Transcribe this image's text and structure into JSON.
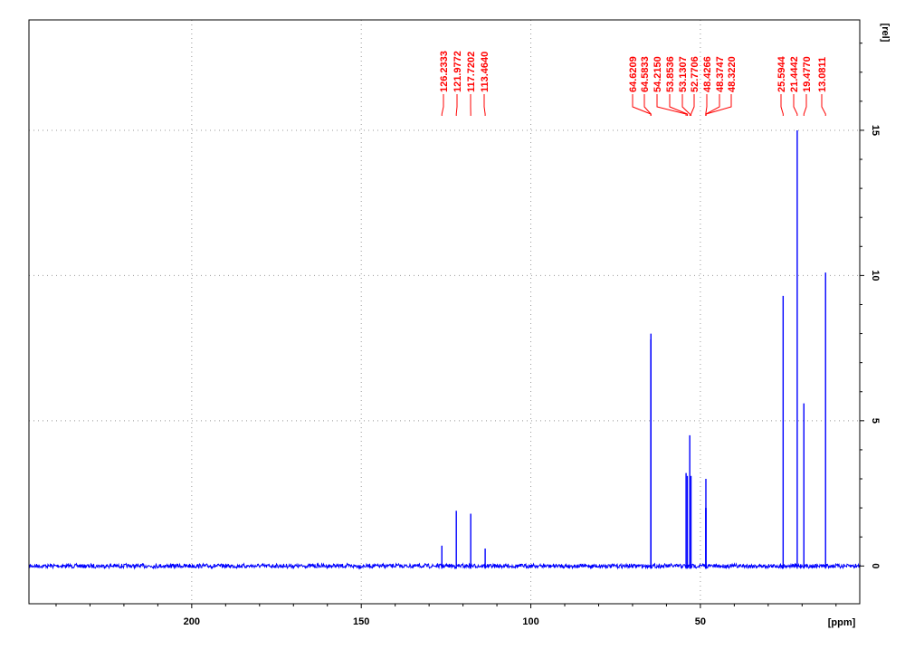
{
  "chart_data": {
    "type": "line",
    "title": "",
    "xlabel": "[ppm]",
    "ylabel": "[rel]",
    "xlim": [
      248,
      3
    ],
    "ylim": [
      -1.3,
      18.8
    ],
    "x_reversed": true,
    "x_ticks": [
      200,
      150,
      100,
      50
    ],
    "y_ticks": [
      0,
      5,
      10,
      15
    ],
    "grid": true,
    "colors": {
      "spectrum": "#0000ff",
      "peak_label": "#ff0000",
      "frame": "#000000",
      "grid": "#999999"
    },
    "peaks": [
      {
        "ppm": 126.2333,
        "height": 0.7
      },
      {
        "ppm": 121.9772,
        "height": 1.9
      },
      {
        "ppm": 117.7202,
        "height": 1.8
      },
      {
        "ppm": 113.464,
        "height": 0.6
      },
      {
        "ppm": 64.6209,
        "height": 7.8
      },
      {
        "ppm": 64.5833,
        "height": 8.0
      },
      {
        "ppm": 54.215,
        "height": 3.2
      },
      {
        "ppm": 53.8536,
        "height": 3.1
      },
      {
        "ppm": 53.1307,
        "height": 4.5
      },
      {
        "ppm": 52.7706,
        "height": 3.1
      },
      {
        "ppm": 48.4266,
        "height": 2.0
      },
      {
        "ppm": 48.3747,
        "height": 3.0
      },
      {
        "ppm": 48.322,
        "height": 2.0
      },
      {
        "ppm": 25.5944,
        "height": 9.3
      },
      {
        "ppm": 21.4442,
        "height": 15.0
      },
      {
        "ppm": 19.477,
        "height": 5.6
      },
      {
        "ppm": 13.0811,
        "height": 10.1
      }
    ],
    "peak_labels": [
      {
        "text": "126.2333",
        "ppm": 126.2333
      },
      {
        "text": "121.9772",
        "ppm": 121.9772
      },
      {
        "text": "117.7202",
        "ppm": 117.7202
      },
      {
        "text": "113.4640",
        "ppm": 113.464
      },
      {
        "text": "64.6209",
        "ppm": 64.6209
      },
      {
        "text": "64.5833",
        "ppm": 64.5833
      },
      {
        "text": "54.2150",
        "ppm": 54.215
      },
      {
        "text": "53.8536",
        "ppm": 53.8536
      },
      {
        "text": "53.1307",
        "ppm": 53.1307
      },
      {
        "text": "52.7706",
        "ppm": 52.7706
      },
      {
        "text": "48.4266",
        "ppm": 48.4266
      },
      {
        "text": "48.3747",
        "ppm": 48.3747
      },
      {
        "text": "48.3220",
        "ppm": 48.322
      },
      {
        "text": "25.5944",
        "ppm": 25.5944
      },
      {
        "text": "21.4442",
        "ppm": 21.4442
      },
      {
        "text": "19.4770",
        "ppm": 19.477
      },
      {
        "text": "13.0811",
        "ppm": 13.0811
      }
    ]
  }
}
